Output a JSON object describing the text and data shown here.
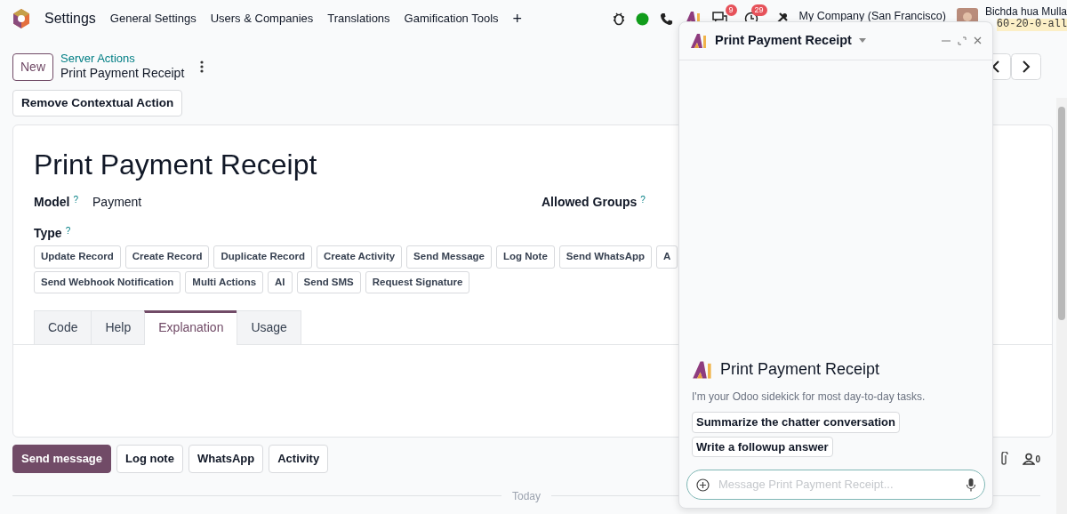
{
  "navbar": {
    "app": "Settings",
    "menus": [
      "General Settings",
      "Users & Companies",
      "Translations",
      "Gamification Tools"
    ],
    "add": "+",
    "messages_badge": "9",
    "activities_badge": "29",
    "company": "My Company (San Francisco)",
    "user": "Bichda hua Mulla",
    "database": "60-20-0-all"
  },
  "control_panel": {
    "new_button": "New",
    "breadcrumb_parent": "Server Actions",
    "breadcrumb_current": "Print Payment Receipt"
  },
  "action_button": "Remove Contextual Action",
  "form": {
    "title": "Print Payment Receipt",
    "fields": [
      {
        "label": "Model",
        "help": "?",
        "value": "Payment"
      },
      {
        "label": "Allowed Groups",
        "help": "?"
      }
    ],
    "type_label": "Type",
    "type_help": "?",
    "type_rows": [
      {
        "options": [
          {
            "label": "Update Record",
            "selected": false
          },
          {
            "label": "Create Record",
            "selected": false
          },
          {
            "label": "Duplicate Record",
            "selected": false
          },
          {
            "label": "Create Activity",
            "selected": false
          },
          {
            "label": "Send Message",
            "selected": false
          },
          {
            "label": "Log Note",
            "selected": false
          },
          {
            "label": "Send WhatsApp",
            "selected": false
          },
          {
            "label": "A",
            "selected": false
          }
        ]
      },
      {
        "options": [
          {
            "label": "Send Webhook Notification",
            "selected": false
          },
          {
            "label": "Multi Actions",
            "selected": false
          },
          {
            "label": "AI",
            "selected": false
          },
          {
            "label": "Send SMS",
            "selected": false
          },
          {
            "label": "Request Signature",
            "selected": false
          }
        ]
      }
    ],
    "tabs": [
      {
        "label": "Code",
        "selected": false
      },
      {
        "label": "Help",
        "selected": false
      },
      {
        "label": "Explanation",
        "selected": true
      },
      {
        "label": "Usage",
        "selected": false
      }
    ]
  },
  "chatter": {
    "buttons": [
      {
        "label": "Send message",
        "selected": true
      },
      {
        "label": "Log note",
        "selected": false
      },
      {
        "label": "WhatsApp",
        "selected": false
      },
      {
        "label": "Activity",
        "selected": false
      }
    ],
    "followers": "0",
    "divider": "Today"
  },
  "assistant": {
    "title": "Print Payment Receipt",
    "intro_title": "Print Payment Receipt",
    "intro_text": "I'm your Odoo sidekick for most day-to-day tasks.",
    "suggestions": [
      "Summarize the chatter conversation",
      "Write a followup answer"
    ],
    "placeholder": "Message Print Payment Receipt..."
  }
}
